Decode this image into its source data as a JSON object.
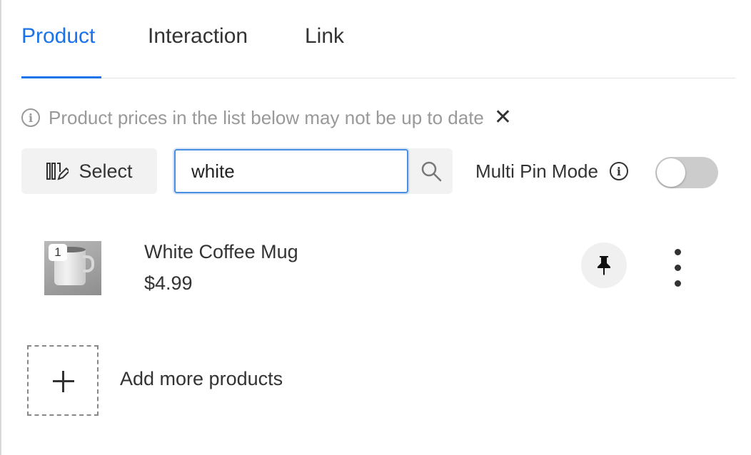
{
  "tabs": [
    {
      "label": "Product",
      "active": true
    },
    {
      "label": "Interaction",
      "active": false
    },
    {
      "label": "Link",
      "active": false
    }
  ],
  "notice": {
    "text": "Product prices in the list below may not be up to date",
    "icon": "info-icon",
    "close_icon": "close-icon"
  },
  "toolbar": {
    "select_label": "Select",
    "search_value": "white",
    "multi_pin_label": "Multi Pin Mode",
    "multi_pin_enabled": false
  },
  "products": [
    {
      "index": "1",
      "name": "White Coffee Mug",
      "price": "$4.99",
      "pin_icon": "pin-icon",
      "menu_icon": "more-vertical-icon"
    }
  ],
  "add_more_label": "Add more products",
  "colors": {
    "accent": "#1a73e8",
    "toggle_off": "#cccccc"
  }
}
